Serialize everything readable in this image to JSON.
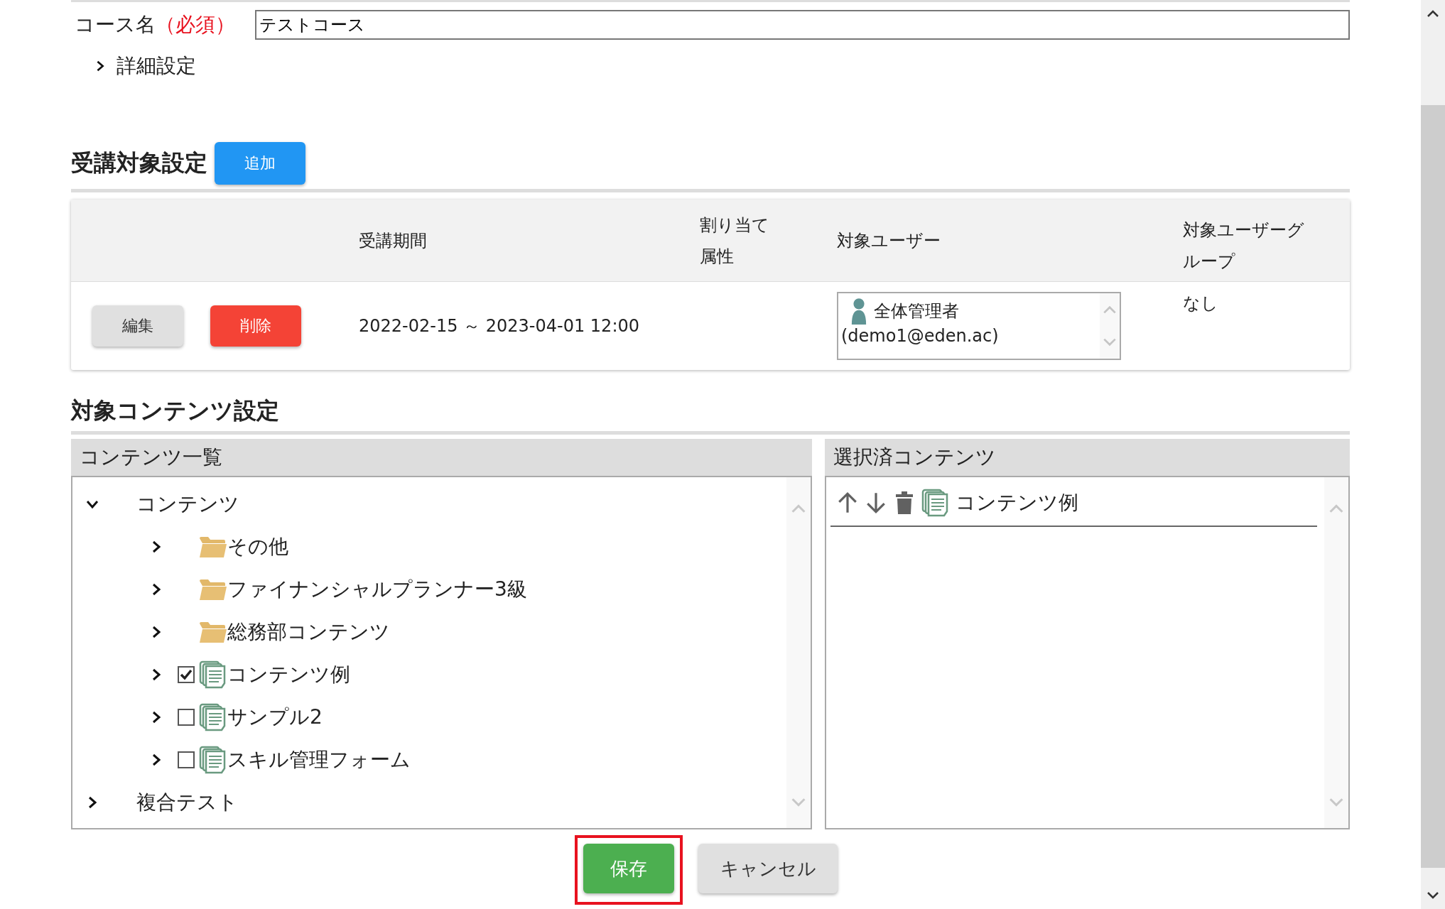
{
  "course_name": {
    "label": "コース名",
    "required": "（必須）",
    "value": "テストコース"
  },
  "advanced": {
    "label": "詳細設定",
    "expanded": false
  },
  "target_section": {
    "title": "受講対象設定",
    "add_button": "追加"
  },
  "target_table": {
    "columns": [
      "受講期間",
      "割り当て属性",
      "対象ユーザー",
      "対象ユーザーグループ"
    ],
    "rows": [
      {
        "edit_button": "編集",
        "delete_button": "削除",
        "period": "2022-02-15 ～ 2023-04-01 12:00",
        "users": [
          {
            "name": "全体管理者",
            "email": "(demo1@eden.ac)"
          }
        ],
        "groups": "なし"
      }
    ]
  },
  "content_section": {
    "title": "対象コンテンツ設定",
    "list_panel": {
      "title": "コンテンツ一覧",
      "tree": [
        {
          "label": "コンテンツ",
          "kind": "category",
          "expanded": true,
          "children": [
            {
              "label": "その他",
              "kind": "folder",
              "expanded": false
            },
            {
              "label": "ファイナンシャルプランナー3級",
              "kind": "folder",
              "expanded": false
            },
            {
              "label": "総務部コンテンツ",
              "kind": "folder",
              "expanded": false
            },
            {
              "label": "コンテンツ例",
              "kind": "content",
              "expanded": false,
              "checked": true
            },
            {
              "label": "サンプル2",
              "kind": "content",
              "expanded": false,
              "checked": false
            },
            {
              "label": "スキル管理フォーム",
              "kind": "content",
              "expanded": false,
              "checked": false
            }
          ]
        },
        {
          "label": "複合テスト",
          "kind": "category",
          "expanded": false
        }
      ]
    },
    "selected_panel": {
      "title": "選択済コンテンツ",
      "items": [
        {
          "label": "コンテンツ例"
        }
      ]
    }
  },
  "footer": {
    "buttons": [
      {
        "label": "保存",
        "kind": "primary",
        "highlighted": true
      },
      {
        "label": "キャンセル",
        "kind": "secondary",
        "highlighted": false
      }
    ]
  }
}
